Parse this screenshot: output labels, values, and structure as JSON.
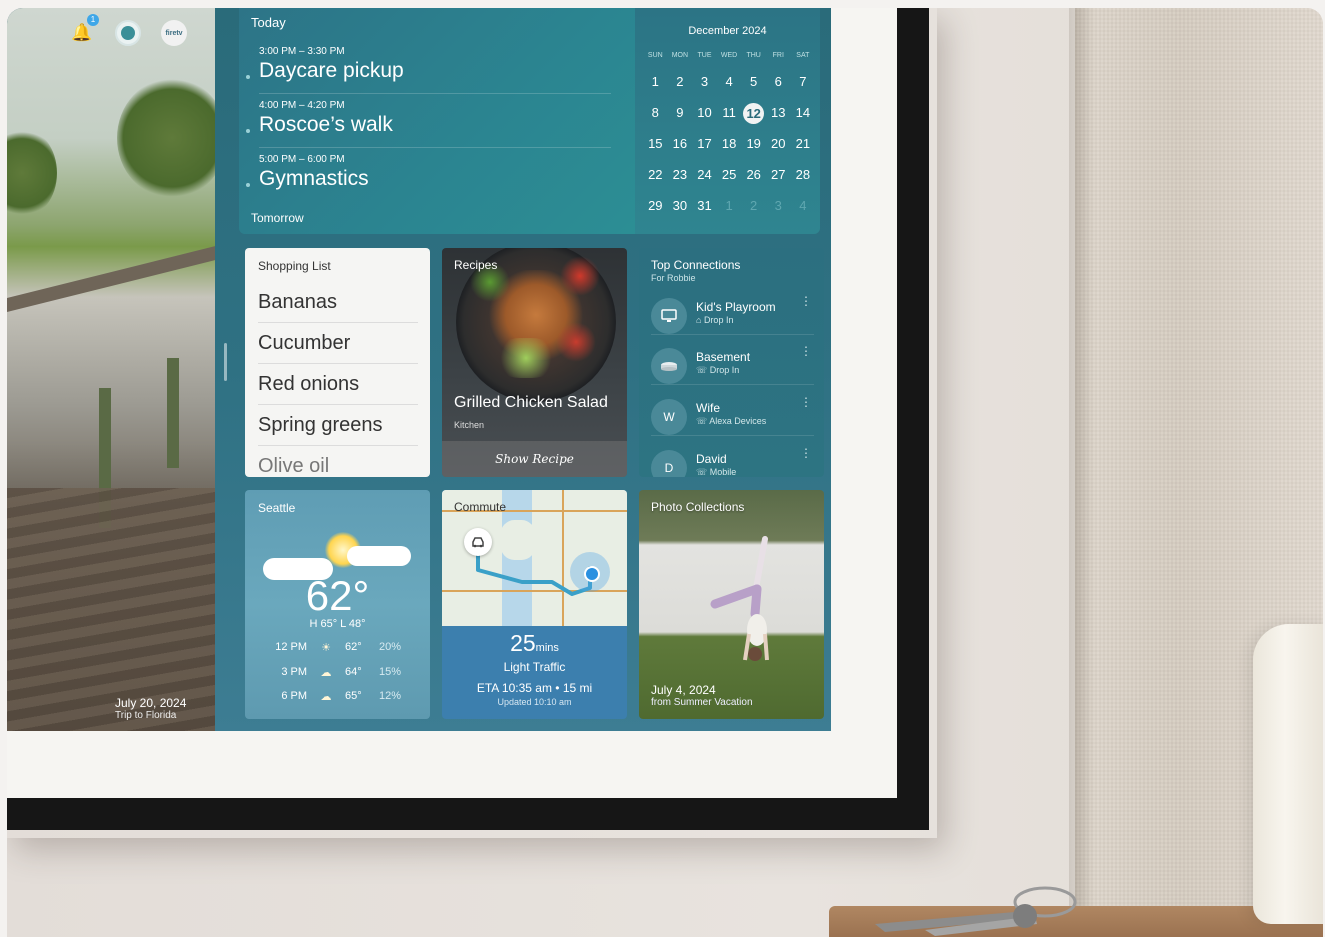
{
  "header": {
    "notification_count": "1",
    "brand_label": "firetv"
  },
  "photo": {
    "date": "July 20, 2024",
    "caption": "Trip to Florida"
  },
  "agenda": {
    "title": "Today",
    "events": [
      {
        "time": "3:00 PM – 3:30 PM",
        "title": "Daycare pickup"
      },
      {
        "time": "4:00 PM – 4:20 PM",
        "title": "Roscoe’s walk"
      },
      {
        "time": "5:00 PM – 6:00 PM",
        "title": "Gymnastics"
      }
    ],
    "next_label": "Tomorrow"
  },
  "calendar": {
    "month": "December 2024",
    "weekdays": [
      "SUN",
      "MON",
      "TUE",
      "WED",
      "THU",
      "FRI",
      "SAT"
    ],
    "today": "12",
    "days": [
      [
        "1",
        "2",
        "3",
        "4",
        "5",
        "6",
        "7"
      ],
      [
        "8",
        "9",
        "10",
        "11",
        "12",
        "13",
        "14"
      ],
      [
        "15",
        "16",
        "17",
        "18",
        "19",
        "20",
        "21"
      ],
      [
        "22",
        "23",
        "24",
        "25",
        "26",
        "27",
        "28"
      ],
      [
        "29",
        "30",
        "31",
        "1",
        "2",
        "3",
        "4"
      ]
    ]
  },
  "shopping": {
    "title": "Shopping List",
    "items": [
      "Bananas",
      "Cucumber",
      "Red onions",
      "Spring greens",
      "Olive oil"
    ]
  },
  "recipe": {
    "label": "Recipes",
    "name": "Grilled Chicken Salad",
    "source": "Kitchen",
    "button": "Show Recipe"
  },
  "connections": {
    "title": "Top Connections",
    "subtitle": "For Robbie",
    "contacts": [
      {
        "initial": "",
        "icon": "monitor-icon",
        "name": "Kid's Playroom",
        "detail": "Drop In",
        "detail_icon": "drop-in-icon"
      },
      {
        "initial": "",
        "icon": "echo-device-icon",
        "name": "Basement",
        "detail": "Drop In",
        "detail_icon": "phone-icon"
      },
      {
        "initial": "W",
        "name": "Wife",
        "detail": "Alexa Devices",
        "detail_icon": "phone-icon"
      },
      {
        "initial": "D",
        "name": "David",
        "detail": "Mobile",
        "detail_icon": "phone-icon"
      }
    ]
  },
  "weather": {
    "city": "Seattle",
    "temp": "62°",
    "high_low": "H 65°  L 48°",
    "forecast": [
      {
        "time": "12 PM",
        "icon": "sun-icon",
        "temp": "62°",
        "precip": "20%"
      },
      {
        "time": "3 PM",
        "icon": "cloud-icon",
        "temp": "64°",
        "precip": "15%"
      },
      {
        "time": "6 PM",
        "icon": "cloud-icon",
        "temp": "65°",
        "precip": "12%"
      }
    ]
  },
  "commute": {
    "title": "Commute",
    "minutes": "25",
    "minutes_unit": "mins",
    "traffic": "Light Traffic",
    "eta": "ETA 10:35 am • 15 mi",
    "updated": "Updated 10:10 am"
  },
  "photo_collections": {
    "title": "Photo Collections",
    "date": "July 4, 2024",
    "caption": "from Summer Vacation"
  }
}
